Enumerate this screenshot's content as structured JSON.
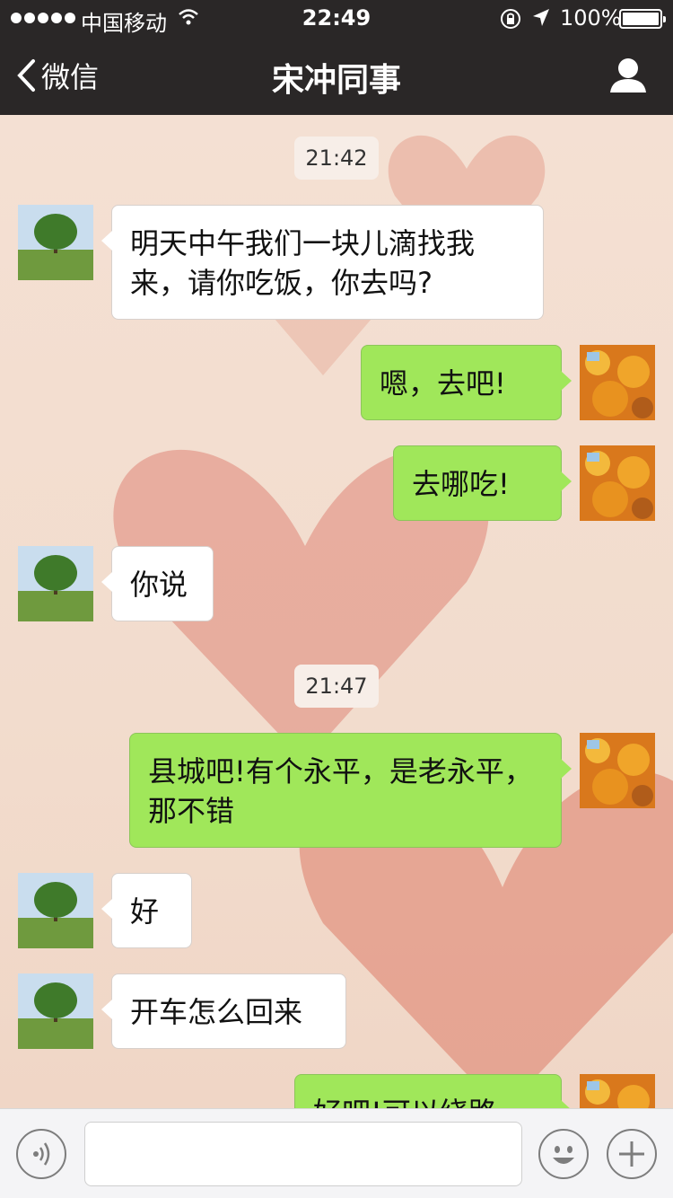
{
  "status_bar": {
    "carrier": "中国移动",
    "time": "22:49",
    "battery": "100%"
  },
  "nav": {
    "back_label": "微信",
    "title": "宋冲同事"
  },
  "messages": [
    {
      "type": "time",
      "text": "21:42"
    },
    {
      "type": "in",
      "text": "明天中午我们一块儿滴找我来，请你吃饭，你去吗?"
    },
    {
      "type": "out",
      "text": "嗯，去吧!"
    },
    {
      "type": "out",
      "text": "去哪吃!"
    },
    {
      "type": "in",
      "text": "你说"
    },
    {
      "type": "time",
      "text": "21:47"
    },
    {
      "type": "out",
      "text": "县城吧!有个永平，是老永平，那不错"
    },
    {
      "type": "in",
      "text": "好"
    },
    {
      "type": "in",
      "text": "开车怎么回来"
    },
    {
      "type": "out",
      "text": "好吧!可以绕路"
    }
  ],
  "input": {
    "placeholder": ""
  },
  "colors": {
    "nav_bg": "#2a2727",
    "out_bubble": "#a0e75a",
    "in_bubble": "#ffffff",
    "heart": "#e5a28f"
  },
  "icons": [
    "signal-icon",
    "wifi-icon",
    "lock-rotation-icon",
    "location-icon",
    "battery-icon",
    "back-chevron-icon",
    "profile-icon",
    "voice-icon",
    "emoji-icon",
    "plus-icon"
  ]
}
